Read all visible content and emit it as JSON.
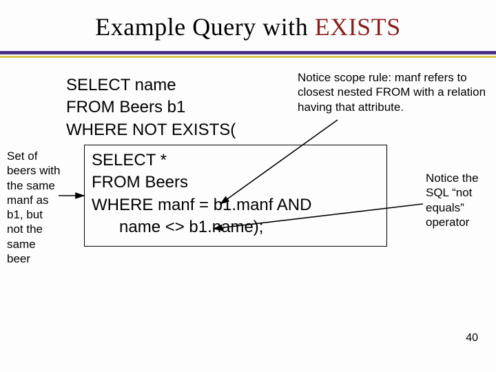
{
  "title": {
    "pre": "Example Query with ",
    "kw": "EXISTS"
  },
  "code": {
    "l1": "SELECT name",
    "l2": "FROM Beers b1",
    "l3": "WHERE NOT EXISTS(",
    "s1": "SELECT *",
    "s2": "FROM Beers",
    "s3": "WHERE manf = b1.manf AND",
    "s4": "      name <> b1.name);"
  },
  "notes": {
    "top_right": "Notice scope rule: manf refers to closest nested FROM with a relation having that attribute.",
    "left": "Set of beers with the same manf as b1, but not the same beer",
    "right": "Notice the SQL “not equals” operator"
  },
  "page": "40"
}
